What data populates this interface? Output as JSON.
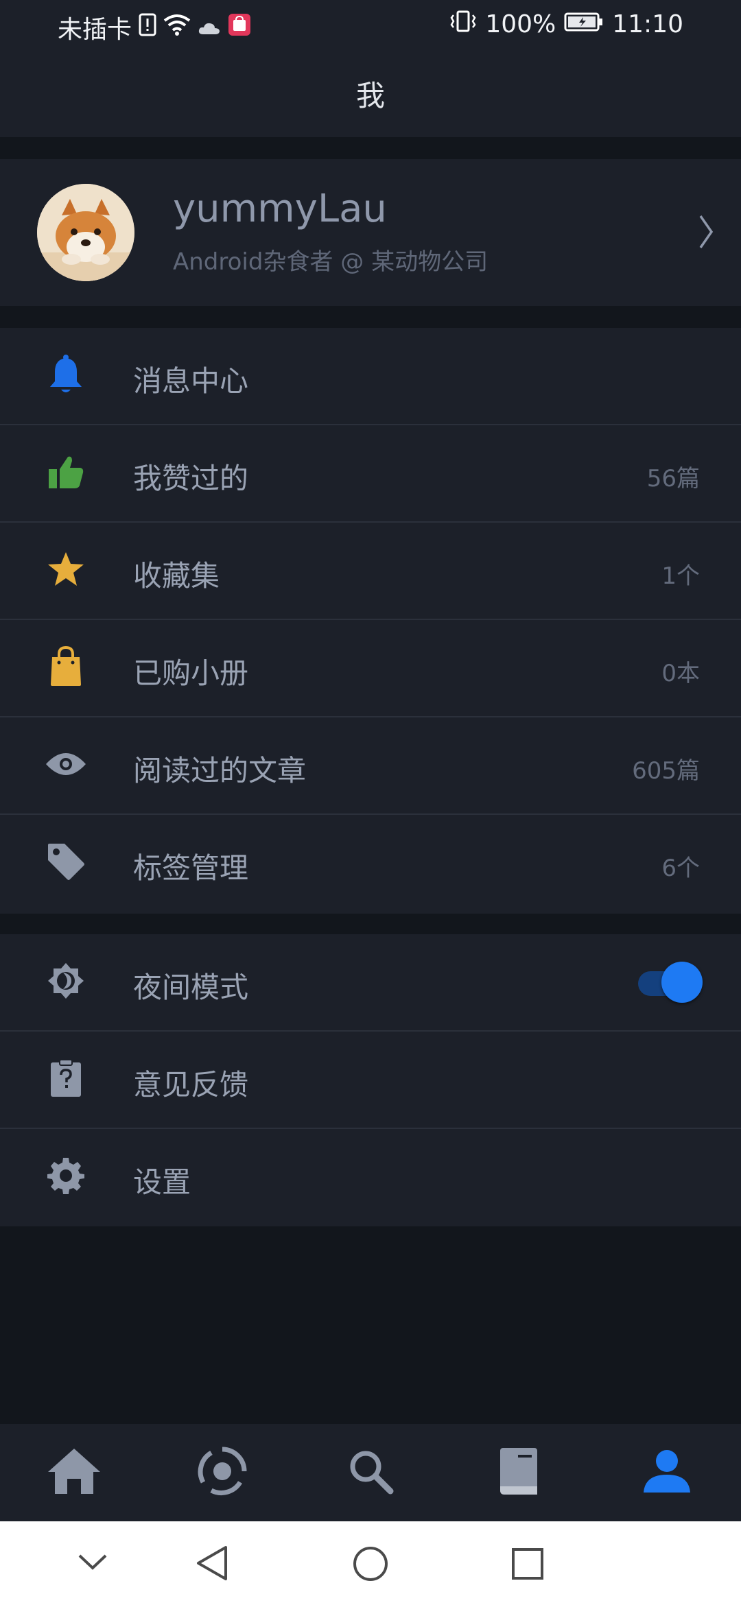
{
  "status_bar": {
    "carrier": "未插卡",
    "battery": "100%",
    "time": "11:10"
  },
  "header": {
    "title": "我"
  },
  "profile": {
    "username": "yummyLau",
    "bio": "Android杂食者 @ 某动物公司"
  },
  "menu_group_1": [
    {
      "label": "消息中心",
      "count": "",
      "icon": "bell-icon",
      "color": "#1e6fe8"
    },
    {
      "label": "我赞过的",
      "count": "56篇",
      "icon": "thumbs-up-icon",
      "color": "#4ca244"
    },
    {
      "label": "收藏集",
      "count": "1个",
      "icon": "star-icon",
      "color": "#e7ae3c"
    },
    {
      "label": "已购小册",
      "count": "0本",
      "icon": "shopping-bag-icon",
      "color": "#e7ae3c"
    },
    {
      "label": "阅读过的文章",
      "count": "605篇",
      "icon": "eye-icon",
      "color": "#8e97a8"
    },
    {
      "label": "标签管理",
      "count": "6个",
      "icon": "tag-icon",
      "color": "#8e97a8"
    }
  ],
  "menu_group_2": [
    {
      "label": "夜间模式",
      "icon": "night-mode-icon",
      "toggle_on": true
    },
    {
      "label": "意见反馈",
      "icon": "feedback-clipboard-icon"
    },
    {
      "label": "设置",
      "icon": "settings-gear-icon"
    }
  ],
  "bottom_nav": [
    {
      "name": "home-icon",
      "active": false
    },
    {
      "name": "pins-icon",
      "active": false
    },
    {
      "name": "search-icon",
      "active": false
    },
    {
      "name": "booklet-icon",
      "active": false
    },
    {
      "name": "profile-icon",
      "active": true
    }
  ],
  "colors": {
    "background": "#12161c",
    "surface": "#1c2029",
    "accent": "#1e7af3",
    "text": "#9aa3b4",
    "muted": "#636b7c"
  }
}
